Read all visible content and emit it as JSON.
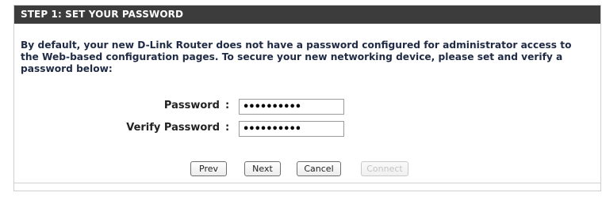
{
  "panel": {
    "title": "STEP 1: SET YOUR PASSWORD",
    "description": "By default, your new D-Link Router does not have a password configured for administrator access to the Web-based configuration pages. To secure your new networking device, please set and verify a password below:"
  },
  "form": {
    "password_label": "Password",
    "verify_label": "Verify Password",
    "colon": ":",
    "password_value": "••••••••••",
    "verify_value": "••••••••••"
  },
  "buttons": {
    "prev": "Prev",
    "next": "Next",
    "cancel": "Cancel",
    "connect": "Connect"
  },
  "colors": {
    "header_bg": "#3c3c3c",
    "header_text": "#ffffff",
    "body_text": "#1f2a44",
    "disabled_text": "#c4c4c4"
  }
}
